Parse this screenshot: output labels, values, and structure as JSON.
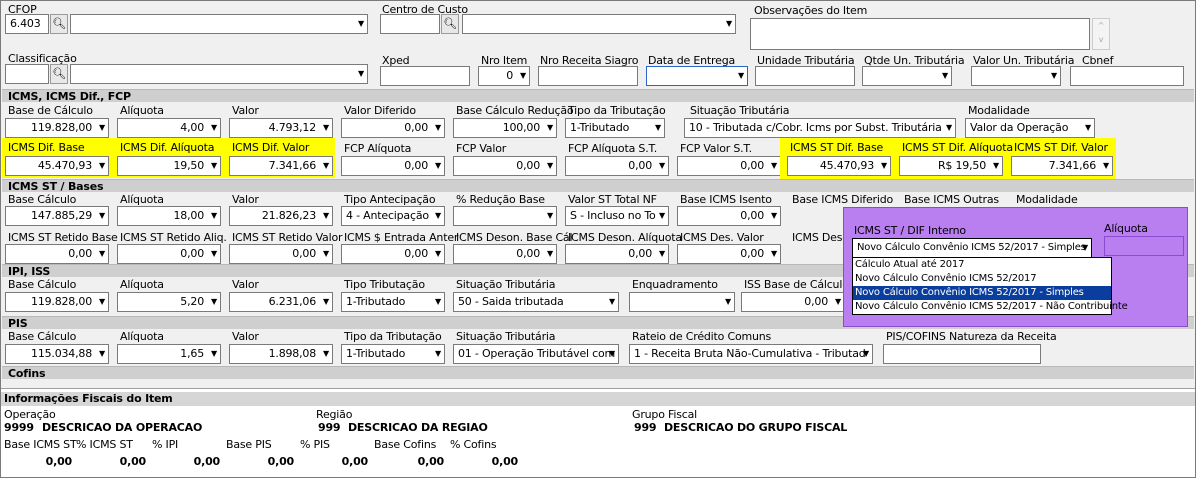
{
  "top": {
    "cfop_label": "CFOP",
    "cfop_value": "6.403",
    "centro_custo_label": "Centro de Custo",
    "obs_label": "Observações do Item",
    "classificacao_label": "Classificação",
    "xped_label": "Xped",
    "nro_item_label": "Nro Item",
    "nro_item_value": "0",
    "nro_receita_label": "Nro Receita Siagro",
    "data_entrega_label": "Data de Entrega",
    "unidade_trib_label": "Unidade Tributária",
    "qtde_un_trib_label": "Qtde Un. Tributária",
    "valor_un_trib_label": "Valor Un. Tributária",
    "cbnef_label": "Cbnef"
  },
  "icms": {
    "title": "ICMS, ICMS Dif., FCP",
    "base_calculo_label": "Base de Cálculo",
    "base_calculo": "119.828,00",
    "aliquota_label": "Alíquota",
    "aliquota": "4,00",
    "valor_label": "Valor",
    "valor": "4.793,12",
    "valor_diferido_label": "Valor Diferido",
    "valor_diferido": "0,00",
    "base_reducao_label": "Base Cálculo Redução",
    "base_reducao": "100,00",
    "tipo_trib_label": "Tipo da Tributação",
    "tipo_trib": "1-Tributado",
    "situacao_label": "Situação Tributária",
    "situacao": "10 - Tributada c/Cobr. Icms por Subst. Tributária",
    "modalidade_label": "Modalidade",
    "modalidade": "Valor da Operação",
    "dif_base_label": "ICMS Dif. Base",
    "dif_base": "45.470,93",
    "dif_aliquota_label": "ICMS Dif. Alíquota",
    "dif_aliquota": "19,50",
    "dif_valor_label": "ICMS Dif. Valor",
    "dif_valor": "7.341,66",
    "fcp_aliquota_label": "FCP Alíquota",
    "fcp_aliquota": "0,00",
    "fcp_valor_label": "FCP Valor",
    "fcp_valor": "0,00",
    "fcp_aliquota_st_label": "FCP Alíquota S.T.",
    "fcp_aliquota_st": "0,00",
    "fcp_valor_st_label": "FCP Valor S.T.",
    "fcp_valor_st": "0,00",
    "st_dif_base_label": "ICMS ST Dif. Base",
    "st_dif_base": "45.470,93",
    "st_dif_aliquota_label": "ICMS ST Dif. Alíquota",
    "st_dif_aliquota": "R$ 19,50",
    "st_dif_valor_label": "ICMS ST Dif. Valor",
    "st_dif_valor": "7.341,66"
  },
  "icms_st": {
    "title": "ICMS ST / Bases",
    "base_calculo_label": "Base Cálculo",
    "base_calculo": "147.885,29",
    "aliquota_label": "Alíquota",
    "aliquota": "18,00",
    "valor_label": "Valor",
    "valor": "21.826,23",
    "tipo_antecipacao_label": "Tipo Antecipação",
    "tipo_antecipacao": "4 - Antecipação",
    "reducao_base_label": "% Redução Base",
    "valor_st_total_label": "Valor ST Total NF",
    "valor_st_total": "S - Incluso no To",
    "base_isento_label": "Base ICMS Isento",
    "base_isento": "0,00",
    "base_diferido_label": "Base ICMS Diferido",
    "base_outras_label": "Base ICMS Outras",
    "modalidade_label": "Modalidade",
    "retido_base_label": "ICMS ST Retido Base",
    "retido_base": "0,00",
    "retido_aliq_label": "ICMS ST Retido Aliq.",
    "retido_aliq": "0,00",
    "retido_valor_label": "ICMS ST Retido Valor",
    "retido_valor": "0,00",
    "entrada_anter_label": "ICMS $ Entrada Anter",
    "entrada_anter": "0,00",
    "deson_base_label": "ICMS Deson. Base Cál",
    "deson_base": "0,00",
    "deson_aliquota_label": "ICMS Deson. Alíquota",
    "deson_aliquota": "0,00",
    "des_valor_label": "ICMS Des. Valor",
    "des_valor": "0,00",
    "desc_label": "ICMS Desc"
  },
  "ipi": {
    "title": "IPI, ISS",
    "base_calculo_label": "Base Cálculo",
    "base_calculo": "119.828,00",
    "aliquota_label": "Alíquota",
    "aliquota": "5,20",
    "valor_label": "Valor",
    "valor": "6.231,06",
    "tipo_trib_label": "Tipo Tributação",
    "tipo_trib": "1-Tributado",
    "situacao_label": "Situação Tributária",
    "situacao": "50 - Saida tributada",
    "enquadramento_label": "Enquadramento",
    "iss_base_label": "ISS Base de Cálculo",
    "iss_base": "0,00"
  },
  "pis": {
    "title": "PIS",
    "base_calculo_label": "Base Cálculo",
    "base_calculo": "115.034,88",
    "aliquota_label": "Alíquota",
    "aliquota": "1,65",
    "valor_label": "Valor",
    "valor": "1.898,08",
    "tipo_trib_label": "Tipo da Tributação",
    "tipo_trib": "1-Tributado",
    "situacao_label": "Situação Tributária",
    "situacao": "01 - Operação Tributável com",
    "rateio_label": "Rateio de Crédito Comuns",
    "rateio": "1 - Receita Bruta Não-Cumulativa - Tributad",
    "natureza_label": "PIS/COFINS Natureza da Receita"
  },
  "cofins": {
    "title": "Cofins"
  },
  "info": {
    "title": "Informações Fiscais do Item",
    "operacao_label": "Operação",
    "operacao_code": "9999",
    "operacao_desc": "DESCRICAO DA OPERACAO",
    "regiao_label": "Região",
    "regiao_code": "999",
    "regiao_desc": "DESCRICAO DA REGIAO",
    "grupo_label": "Grupo Fiscal",
    "grupo_code": "999",
    "grupo_desc": "DESCRICAO DO GRUPO FISCAL",
    "cols": [
      "Base ICMS ST",
      "% ICMS ST",
      "% IPI",
      "Base PIS",
      "% PIS",
      "Base Cofins",
      "% Cofins"
    ],
    "vals": [
      "0,00",
      "0,00",
      "0,00",
      "0,00",
      "0,00",
      "0,00",
      "0,00"
    ]
  },
  "popup": {
    "label": "ICMS ST / DIF Interno",
    "aliquota_label": "Alíquota",
    "selected": "Novo Cálculo Convênio ICMS 52/2017 - Simples",
    "options": [
      "Cálculo Atual até 2017",
      "Novo Cálculo Convênio ICMS 52/2017",
      "Novo Cálculo Convênio ICMS 52/2017 - Simples",
      "Novo Cálculo Convênio ICMS 52/2017 - Não Contribuinte"
    ]
  },
  "colors": {
    "highlight": "#ffff00",
    "popup": "#b97ff0",
    "selection": "#0a3e9e",
    "band": "#cfcfcf"
  }
}
